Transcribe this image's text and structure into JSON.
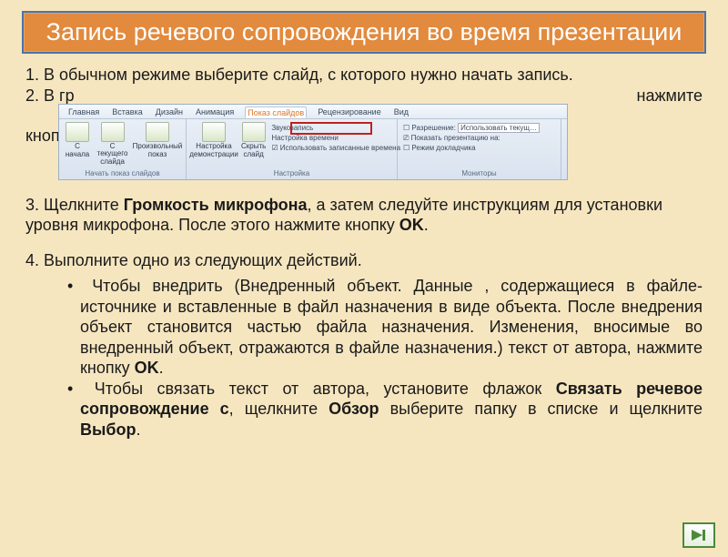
{
  "title": "Запись речевого сопровождения во время презентации",
  "steps": {
    "s1": "1. В обычном режиме выберите слайд, с которого нужно начать запись.",
    "s2_left": "2. В гр",
    "s2_right": "нажмите",
    "s2_line2": "кнопку",
    "s3_pre": "3. Щелкните ",
    "s3_bold": "Громкость микрофона",
    "s3_mid": ", а затем следуйте инструкциям для установки уровня микрофона. После этого нажмите кнопку ",
    "s3_ok": "OK",
    "s3_post": ".",
    "s4_head": "4. Выполните одно из следующих действий.",
    "s4_li1_pre": "Чтобы внедрить (Внедренный объект. Данные , содержащиеся в файле-источнике и вставленные в файл назначения в виде объекта. После внедрения объект становится частью файла назначения. Изменения, вносимые во внедренный объект, отражаются в файле назначения.) текст от автора, нажмите кнопку ",
    "s4_li1_ok": "OK",
    "s4_li1_post": ".",
    "s4_li2_a": "Чтобы связать текст от автора, установите флажок ",
    "s4_li2_b": "Связать речевое сопровождение с",
    "s4_li2_c": ", щелкните ",
    "s4_li2_d": "Обзор",
    "s4_li2_e": " выберите папку в списке и щелкните ",
    "s4_li2_f": "Выбор",
    "s4_li2_g": "."
  },
  "ribbon": {
    "tabs": [
      "Главная",
      "Вставка",
      "Дизайн",
      "Анимация",
      "Показ слайдов",
      "Рецензирование",
      "Вид"
    ],
    "active_tab_index": 4,
    "group1": {
      "label": "Начать показ слайдов",
      "btn1_l1": "С",
      "btn1_l2": "начала",
      "btn2_l1": "С текущего",
      "btn2_l2": "слайда",
      "btn3_l1": "Произвольный",
      "btn3_l2": "показ"
    },
    "group2": {
      "label": "Настройка",
      "btn1_l1": "Настройка",
      "btn1_l2": "демонстрации",
      "btn2_l1": "Скрыть",
      "btn2_l2": "слайд",
      "opt1": "Звукозапись",
      "opt2": "Настройка времени",
      "opt3": "Использовать записанные времена"
    },
    "group3": {
      "label": "Мониторы",
      "opt1": "Разрешение:",
      "opt1v": "Использовать текущ…",
      "opt2": "Показать презентацию на:",
      "opt3": "Режим докладчика"
    }
  },
  "nav": {
    "icon": "next-arrow"
  }
}
